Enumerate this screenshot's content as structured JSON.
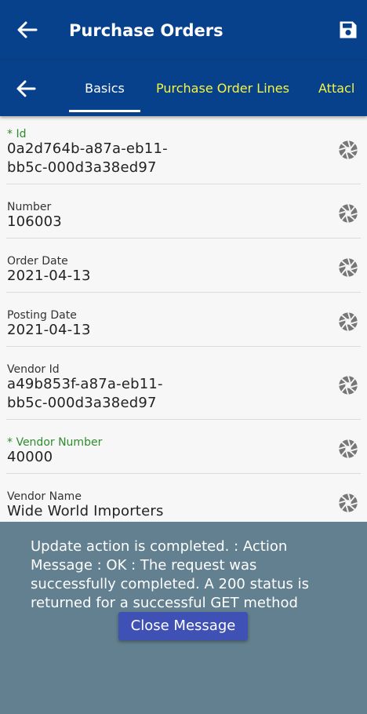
{
  "appbar": {
    "title": "Purchase Orders",
    "back_icon": "arrow-left-icon",
    "save_icon": "save-icon"
  },
  "tabs": {
    "back_icon": "arrow-left-icon",
    "items": [
      {
        "label": "Basics",
        "active": true
      },
      {
        "label": "Purchase Order Lines",
        "active": false
      },
      {
        "label": "Attacl",
        "active": false
      }
    ]
  },
  "fields": [
    {
      "label": "* Id",
      "required": true,
      "value_lines": [
        "0a2d764b-a87a-eb11-",
        "bb5c-000d3a38ed97"
      ]
    },
    {
      "label": "Number",
      "required": false,
      "value_lines": [
        "106003"
      ]
    },
    {
      "label": "Order Date",
      "required": false,
      "value_lines": [
        "2021-04-13"
      ]
    },
    {
      "label": "Posting Date",
      "required": false,
      "value_lines": [
        "2021-04-13"
      ]
    },
    {
      "label": "Vendor Id",
      "required": false,
      "value_lines": [
        "a49b853f-a87a-eb11-",
        "bb5c-000d3a38ed97"
      ]
    },
    {
      "label": "* Vendor Number",
      "required": true,
      "value_lines": [
        "40000"
      ]
    },
    {
      "label": "Vendor Name",
      "required": false,
      "value_lines": [
        "Wide World Importers"
      ]
    }
  ],
  "field_icon": "camera-aperture-icon",
  "message": {
    "text": "Update action is completed.  : Action Message : OK : The request was successfully completed. A 200 status is returned for a successful GET method",
    "close_label": "Close Message"
  },
  "colors": {
    "primary": "#08418b",
    "tab_inactive": "#f5f542",
    "required_label": "#2e8b2e",
    "overlay": "#62808f",
    "button": "#3f51b5"
  }
}
